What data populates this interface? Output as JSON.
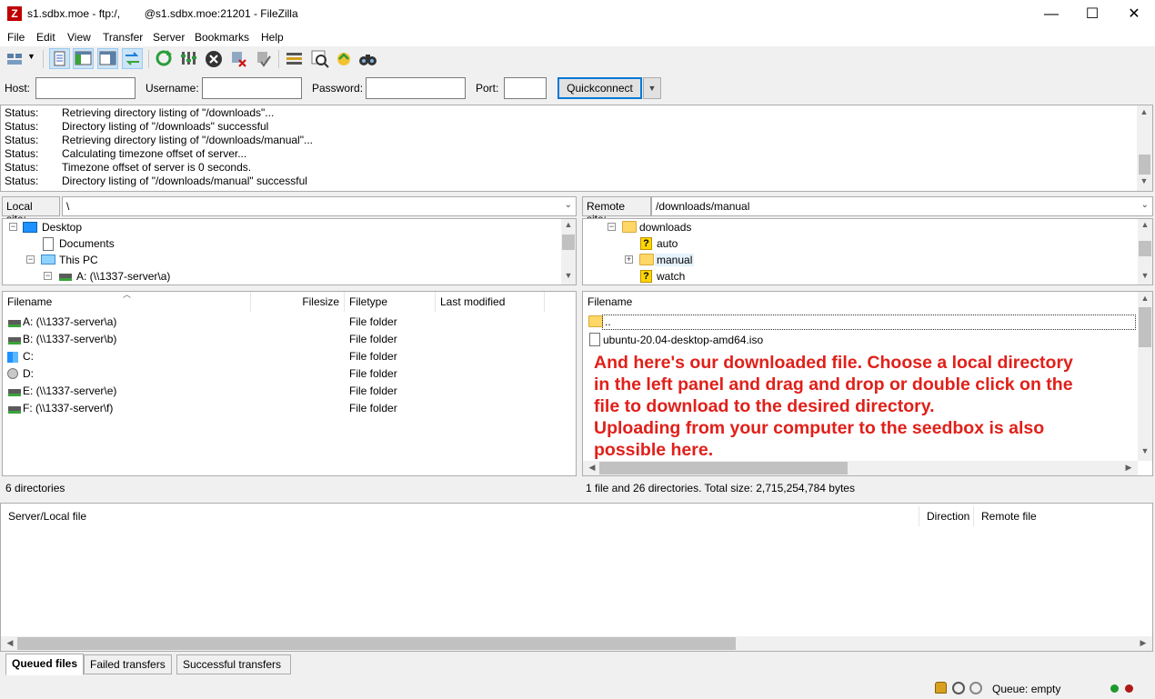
{
  "window": {
    "title": "s1.sdbx.moe - ftp:/,        @s1.sdbx.moe:21201 - FileZilla",
    "minimize": "—",
    "maximize": "☐",
    "close": "✕"
  },
  "menu": [
    "File",
    "Edit",
    "View",
    "Transfer",
    "Server",
    "Bookmarks",
    "Help"
  ],
  "quickconnect": {
    "host_label": "Host:",
    "username_label": "Username:",
    "password_label": "Password:",
    "port_label": "Port:",
    "host_value": "",
    "username_value": "",
    "password_value": "",
    "port_value": "",
    "button": "Quickconnect"
  },
  "log": [
    {
      "k": "Status:",
      "v": "Retrieving directory listing of \"/downloads\"..."
    },
    {
      "k": "Status:",
      "v": "Directory listing of \"/downloads\" successful"
    },
    {
      "k": "Status:",
      "v": "Retrieving directory listing of \"/downloads/manual\"..."
    },
    {
      "k": "Status:",
      "v": "Calculating timezone offset of server..."
    },
    {
      "k": "Status:",
      "v": "Timezone offset of server is 0 seconds."
    },
    {
      "k": "Status:",
      "v": "Directory listing of \"/downloads/manual\" successful"
    }
  ],
  "local": {
    "site_label": "Local site:",
    "path": "\\",
    "tree": [
      "Desktop",
      "Documents",
      "This PC",
      "A: (\\\\1337-server\\a)"
    ],
    "columns": [
      "Filename",
      "Filesize",
      "Filetype",
      "Last modified"
    ],
    "files": [
      {
        "name": "A: (\\\\1337-server\\a)",
        "type": "File folder"
      },
      {
        "name": "B: (\\\\1337-server\\b)",
        "type": "File folder"
      },
      {
        "name": "C:",
        "type": "File folder"
      },
      {
        "name": "D:",
        "type": "File folder"
      },
      {
        "name": "E: (\\\\1337-server\\e)",
        "type": "File folder"
      },
      {
        "name": "F: (\\\\1337-server\\f)",
        "type": "File folder"
      }
    ],
    "status": "6 directories"
  },
  "remote": {
    "site_label": "Remote site:",
    "path": "/downloads/manual",
    "tree": [
      "downloads",
      "auto",
      "manual",
      "watch"
    ],
    "columns": [
      "Filename"
    ],
    "files": [
      "..",
      "ubuntu-20.04-desktop-amd64.iso"
    ],
    "status": "1 file and 26 directories. Total size: 2,715,254,784 bytes"
  },
  "annotation": [
    "And here's our downloaded file. Choose a local directory",
    "in the left panel and drag and drop or double click on the",
    "file to download to the desired directory.",
    "Uploading from your computer to the seedbox is also",
    "possible here."
  ],
  "queue": {
    "columns": [
      "Server/Local file",
      "Direction",
      "Remote file"
    ],
    "tabs": [
      "Queued files",
      "Failed transfers",
      "Successful transfers"
    ],
    "status": "Queue: empty"
  },
  "colors": {
    "annotation": "#e0201a",
    "accent": "#0078d7",
    "folder": "#ffd766"
  }
}
